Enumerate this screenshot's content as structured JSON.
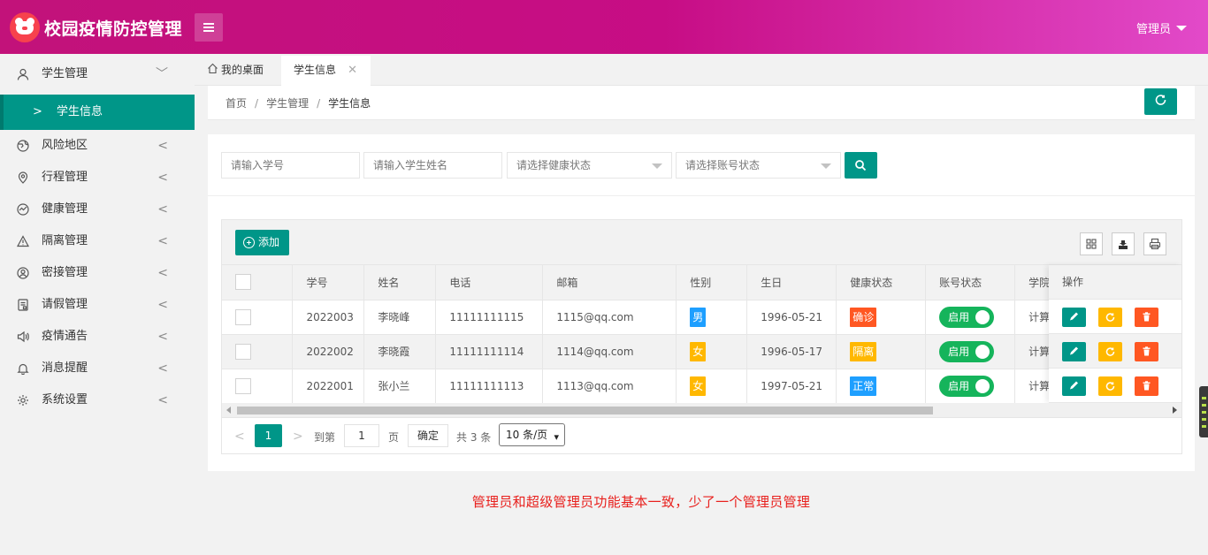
{
  "header": {
    "app_title": "校园疫情防控管理",
    "user_label": "管理员"
  },
  "sidebar": {
    "items": [
      {
        "label": "学生管理",
        "icon": "user-icon",
        "expanded": true
      },
      {
        "label": "风险地区",
        "icon": "globe-icon"
      },
      {
        "label": "行程管理",
        "icon": "location-pin-icon"
      },
      {
        "label": "健康管理",
        "icon": "chart-line-icon"
      },
      {
        "label": "隔离管理",
        "icon": "warning-icon"
      },
      {
        "label": "密接管理",
        "icon": "user-circle-icon"
      },
      {
        "label": "请假管理",
        "icon": "form-icon"
      },
      {
        "label": "疫情通告",
        "icon": "speaker-icon"
      },
      {
        "label": "消息提醒",
        "icon": "bell-icon"
      },
      {
        "label": "系统设置",
        "icon": "gear-icon"
      }
    ],
    "active_sub_item": "学生信息"
  },
  "tabs": {
    "home": "我的桌面",
    "active": "学生信息"
  },
  "breadcrumb": {
    "items": [
      "首页",
      "学生管理",
      "学生信息"
    ]
  },
  "search": {
    "student_id_placeholder": "请输入学号",
    "student_name_placeholder": "请输入学生姓名",
    "health_status_placeholder": "请选择健康状态",
    "account_status_placeholder": "请选择账号状态"
  },
  "toolbar": {
    "add_label": "添加"
  },
  "table": {
    "columns": [
      "学号",
      "姓名",
      "电话",
      "邮箱",
      "性别",
      "生日",
      "健康状态",
      "账号状态",
      "学院",
      "操作"
    ],
    "college_visible_text": "学院",
    "rows": [
      {
        "id": "2022003",
        "name": "李晓峰",
        "phone": "11111111115",
        "email": "1115@qq.com",
        "gender": "男",
        "gender_color": "#1e9fff",
        "birthday": "1996-05-21",
        "health": "确诊",
        "health_color": "#ff5722",
        "account": "启用",
        "college": "计算"
      },
      {
        "id": "2022002",
        "name": "李晓霞",
        "phone": "11111111114",
        "email": "1114@qq.com",
        "gender": "女",
        "gender_color": "#ffb800",
        "birthday": "1996-05-17",
        "health": "隔离",
        "health_color": "#ffb800",
        "account": "启用",
        "college": "计算"
      },
      {
        "id": "2022001",
        "name": "张小兰",
        "phone": "11111111113",
        "email": "1113@qq.com",
        "gender": "女",
        "gender_color": "#ffb800",
        "birthday": "1997-05-21",
        "health": "正常",
        "health_color": "#1e9fff",
        "account": "启用",
        "college": "计算"
      }
    ]
  },
  "pagination": {
    "current_page": "1",
    "goto_label": "到第",
    "goto_value": "1",
    "page_label": "页",
    "confirm_label": "确定",
    "total_label": "共 3 条",
    "page_size": "10 条/页"
  },
  "caption": "管理员和超级管理员功能基本一致，少了一个管理员管理",
  "colors": {
    "header_start": "#c2127a",
    "header_end": "#e24ac9",
    "accent": "#009688",
    "warning": "#ffb800",
    "danger": "#ff5722",
    "info": "#1e9fff",
    "toggle_on": "#15b45b",
    "caption": "#e8201d"
  }
}
